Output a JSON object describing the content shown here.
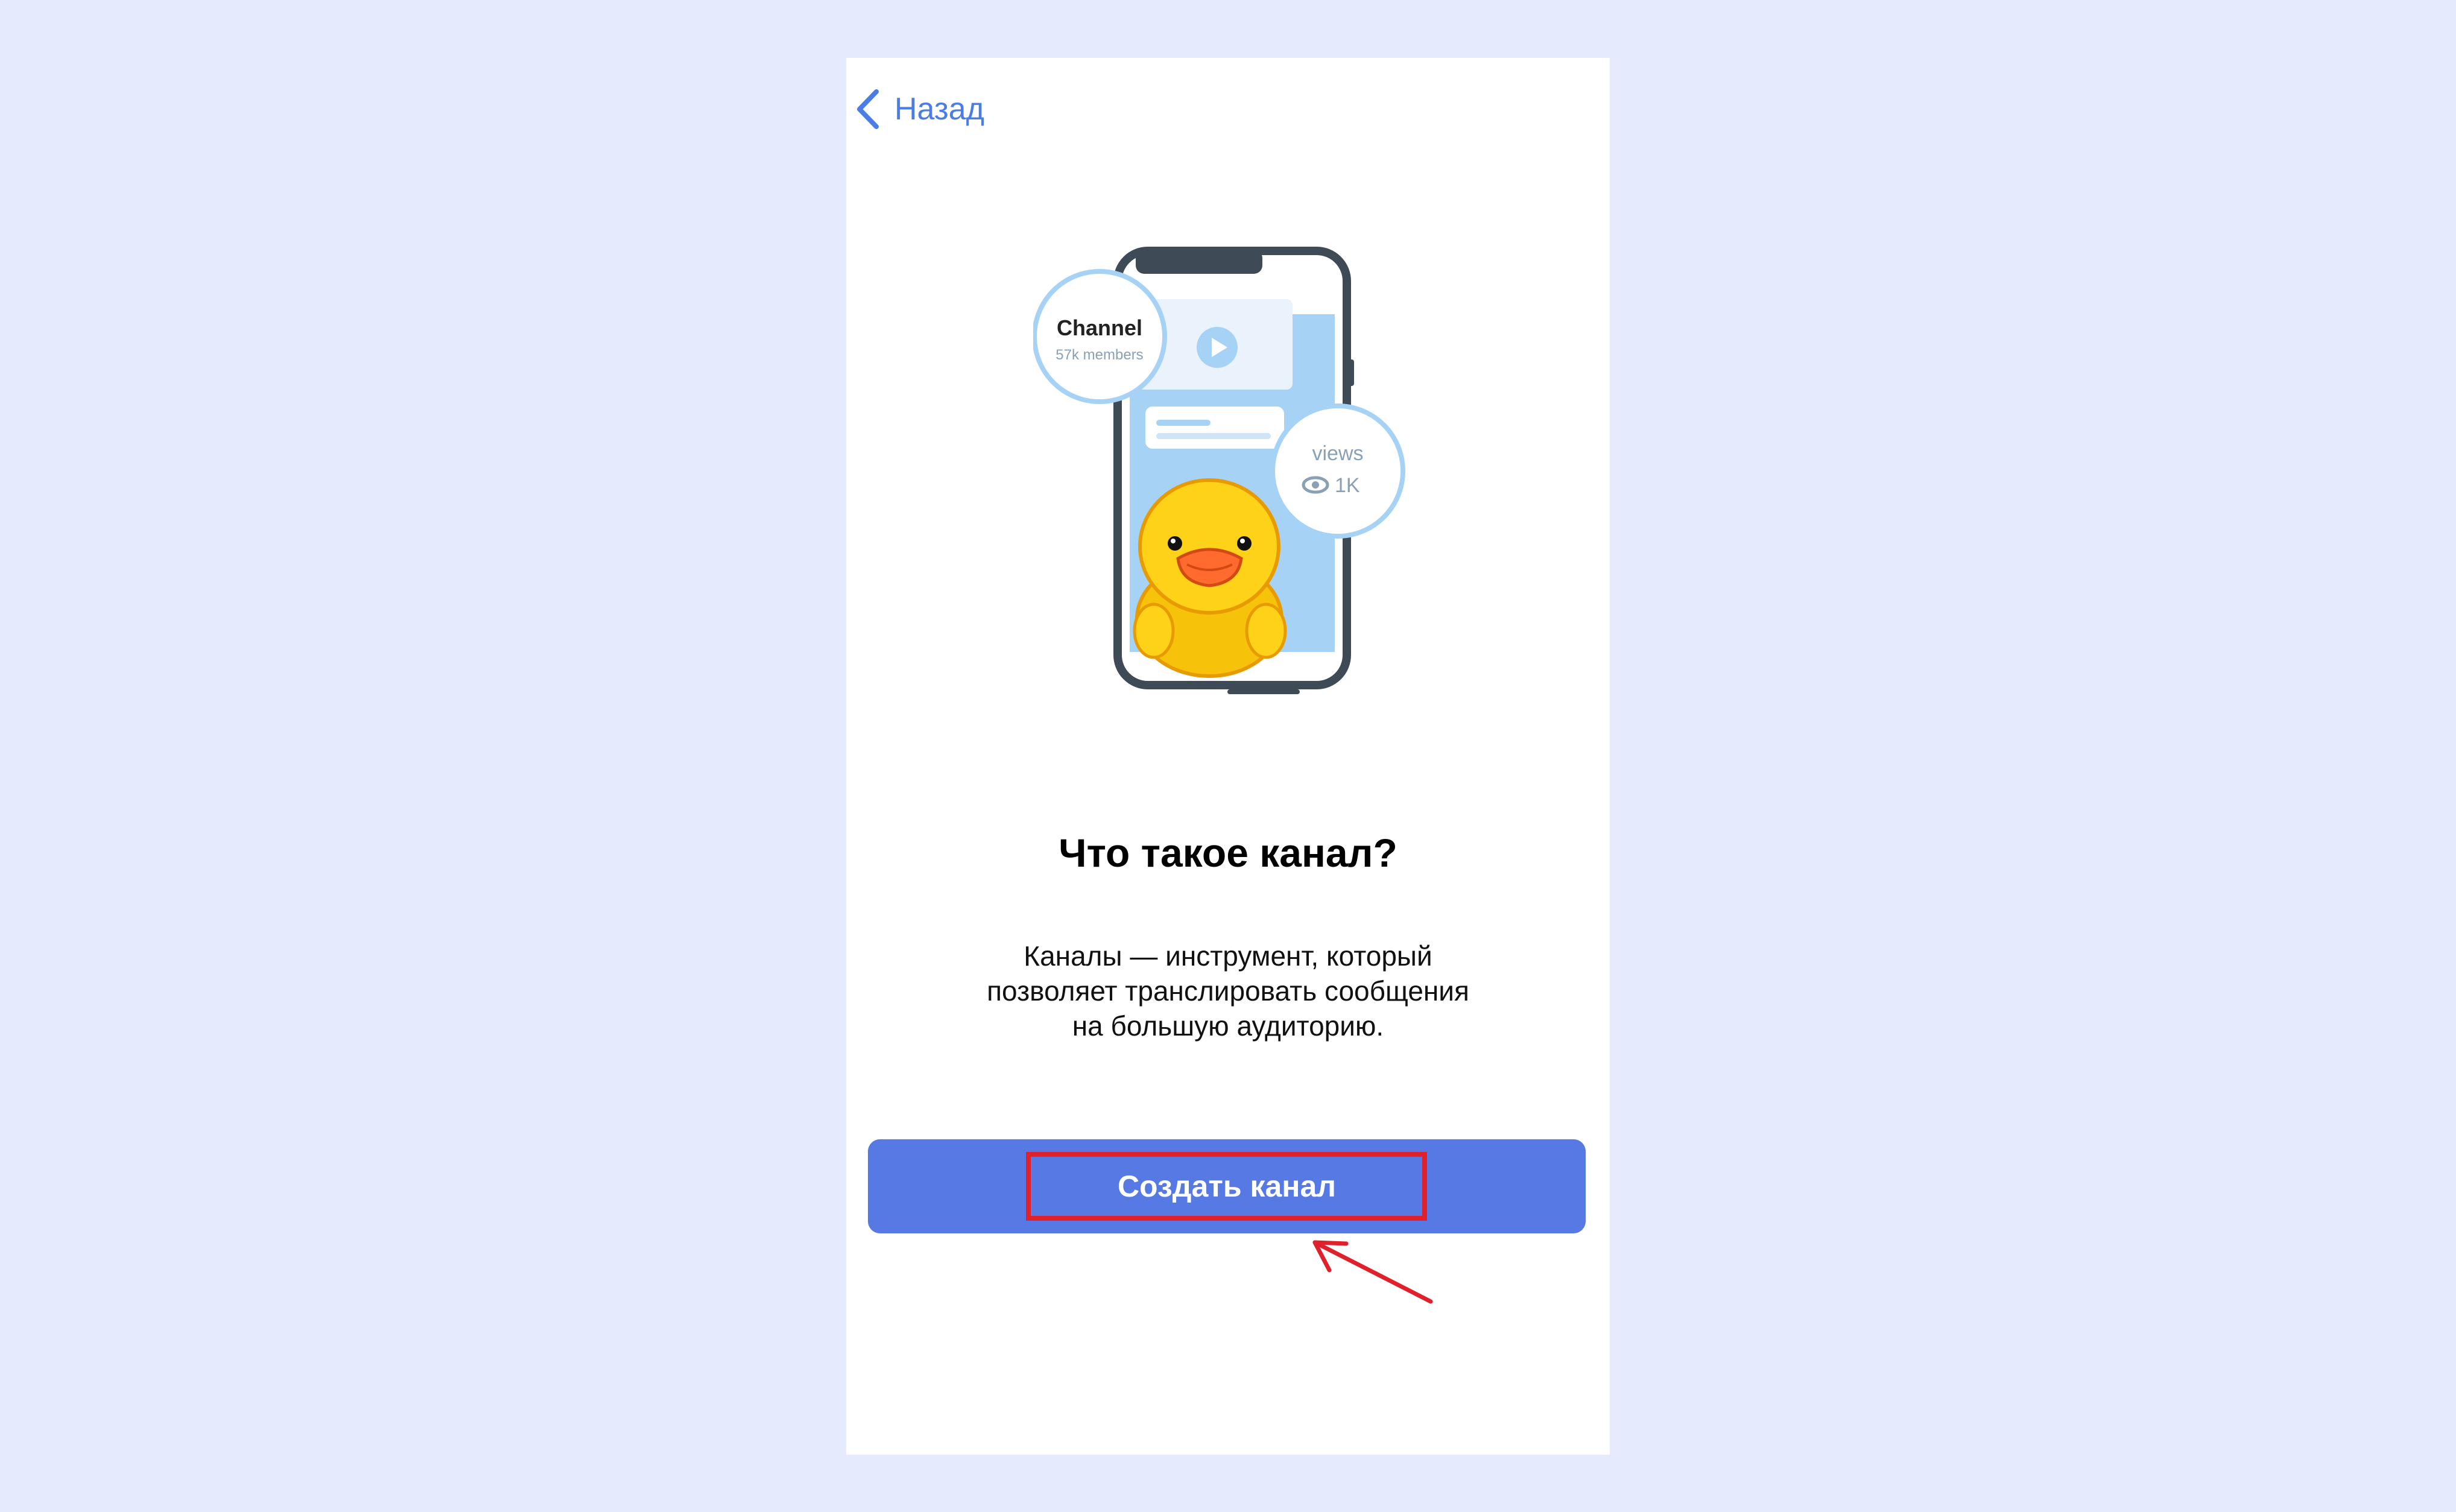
{
  "nav": {
    "back_label": "Назад"
  },
  "illustration": {
    "channel_name": "Channel",
    "channel_members": "57k members",
    "views_label": "views",
    "views_count": "1K"
  },
  "content": {
    "title": "Что такое канал?",
    "description_lines": [
      "Каналы — инструмент, который",
      "позволяет транслировать сообщения",
      "на большую аудиторию."
    ]
  },
  "cta": {
    "label": "Создать канал"
  },
  "colors": {
    "accent": "#4a7de6",
    "button": "#5679e3",
    "highlight": "#e0202a",
    "background": "#e5eafd"
  }
}
